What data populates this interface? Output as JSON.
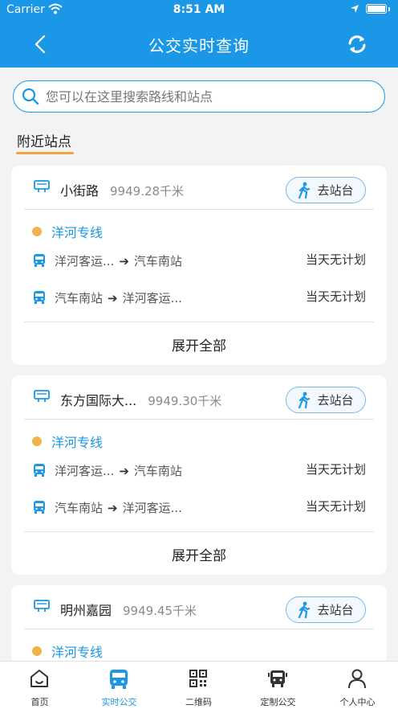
{
  "status_bar": {
    "carrier": "Carrier",
    "time": "8:51 AM"
  },
  "nav": {
    "title": "公交实时查询"
  },
  "search": {
    "placeholder": "您可以在这里搜索路线和站点"
  },
  "section": {
    "title": "附近站点"
  },
  "colors": {
    "accent": "#1a97e6",
    "underline": "#f0a43a",
    "dot": "#f0b34c"
  },
  "stops": [
    {
      "name": "小街路",
      "distance": "9949.28千米",
      "go_label": "去站台",
      "line": "洋河专线",
      "directions": [
        {
          "from": "洋河客运...",
          "to": "汽车南站",
          "plan": "当天无计划"
        },
        {
          "from": "汽车南站",
          "to": "洋河客运...",
          "plan": "当天无计划"
        }
      ],
      "expand_label": "展开全部"
    },
    {
      "name": "东方国际大...",
      "distance": "9949.30千米",
      "go_label": "去站台",
      "line": "洋河专线",
      "directions": [
        {
          "from": "洋河客运...",
          "to": "汽车南站",
          "plan": "当天无计划"
        },
        {
          "from": "汽车南站",
          "to": "洋河客运...",
          "plan": "当天无计划"
        }
      ],
      "expand_label": "展开全部"
    },
    {
      "name": "明州嘉园",
      "distance": "9949.45千米",
      "go_label": "去站台",
      "line": "洋河专线"
    }
  ],
  "tabs": [
    {
      "label": "首页",
      "icon": "home-icon"
    },
    {
      "label": "实时公交",
      "icon": "bus-icon",
      "active": true
    },
    {
      "label": "二维码",
      "icon": "qr-code-icon"
    },
    {
      "label": "定制公交",
      "icon": "custom-bus-icon"
    },
    {
      "label": "个人中心",
      "icon": "person-icon"
    }
  ]
}
